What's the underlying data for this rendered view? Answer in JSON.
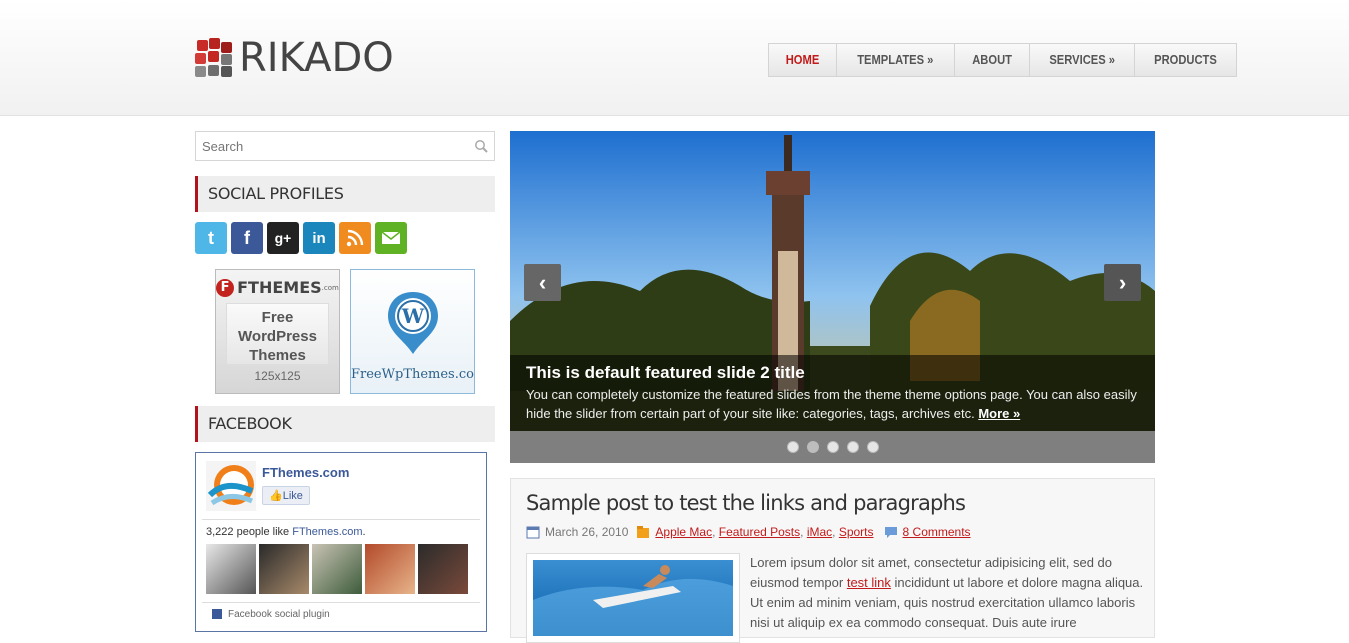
{
  "site": {
    "name": "RIKADO"
  },
  "nav": {
    "items": [
      {
        "label": "HOME",
        "active": true
      },
      {
        "label": "TEMPLATES »"
      },
      {
        "label": "ABOUT"
      },
      {
        "label": "SERVICES »"
      },
      {
        "label": "PRODUCTS"
      }
    ]
  },
  "search": {
    "placeholder": "Search"
  },
  "sidebar": {
    "social_title": "SOCIAL PROFILES",
    "social_icons": [
      "twitter-icon",
      "facebook-icon",
      "google-plus-icon",
      "linkedin-icon",
      "rss-icon",
      "email-icon"
    ],
    "ad1": {
      "brand": "FTHEMES",
      "brand_suffix": ".com",
      "line1": "Free",
      "line2": "WordPress",
      "line3": "Themes",
      "size": "125x125"
    },
    "ad2": {
      "label": "FreeWpThemes.co"
    },
    "facebook_title": "FACEBOOK",
    "facebook": {
      "page_name": "FThemes.com",
      "like_label": "Like",
      "count_text": "3,222 people like ",
      "count_link": "FThemes.com",
      "count_suffix": ".",
      "plugin_label": "Facebook social plugin"
    }
  },
  "slider": {
    "title": "This is default featured slide 2 title",
    "text": "You can completely customize the featured slides from the theme theme options page. You can also easily hide the slider from certain part of your site like: categories, tags, archives etc.",
    "more": "More »",
    "prev": "‹",
    "next": "›",
    "active_dot": 1
  },
  "post": {
    "title": "Sample post to test the links and paragraphs",
    "date": "March 26, 2010",
    "categories": [
      "Apple Mac",
      "Featured Posts",
      "iMac",
      "Sports"
    ],
    "comments": "8 Comments",
    "excerpt_before": "Lorem ipsum dolor sit amet, consectetur adipisicing elit, sed do eiusmod tempor ",
    "excerpt_link": "test link",
    "excerpt_after": " incididunt ut labore et dolore magna aliqua. Ut enim ad minim veniam, quis nostrud exercitation ullamco laboris nisi ut aliquip ex ea commodo consequat. Duis aute irure"
  },
  "colors": {
    "accent": "#c21a1a",
    "facebook": "#3b5998"
  }
}
